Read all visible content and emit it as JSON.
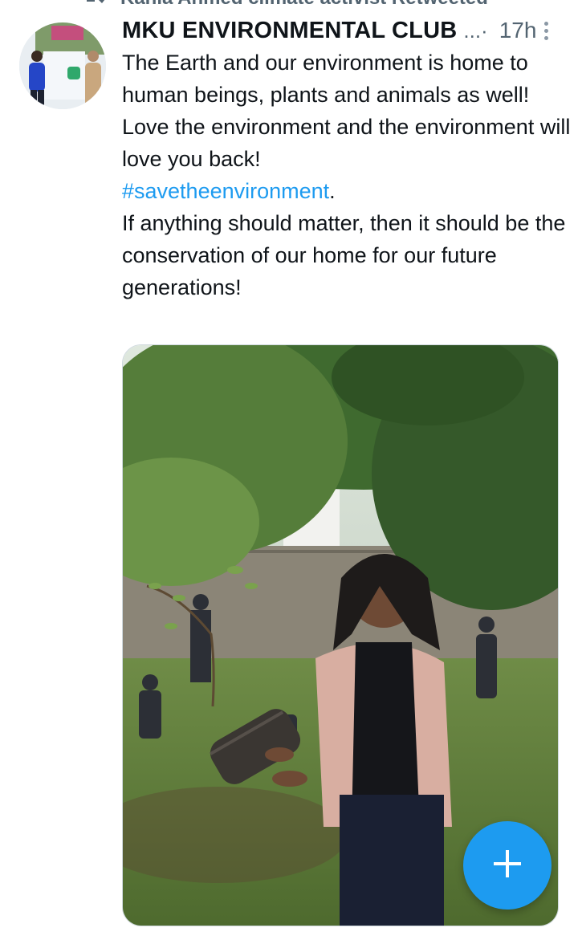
{
  "retweet": {
    "text": "Kahla Ahmed climate activist Retweeted",
    "icon": "retweet-icon"
  },
  "tweet": {
    "author_name": "MKU ENVIRONMENTAL CLUB",
    "name_truncation": "...·",
    "time": "17h",
    "more_icon": "more-vertical-icon",
    "line1": "The Earth and our environment is home to human beings, plants and animals as well!",
    "line2": "Love the environment and the environment will love you back!",
    "hashtag": "#savetheenvironment",
    "hashtag_suffix": ".",
    "line3": "If anything should matter, then it should be the conservation of our home for our future generations!"
  },
  "fab": {
    "icon": "plus-icon"
  },
  "colors": {
    "accent": "#1d9bf0",
    "text": "#0f1419",
    "secondary": "#536471"
  }
}
